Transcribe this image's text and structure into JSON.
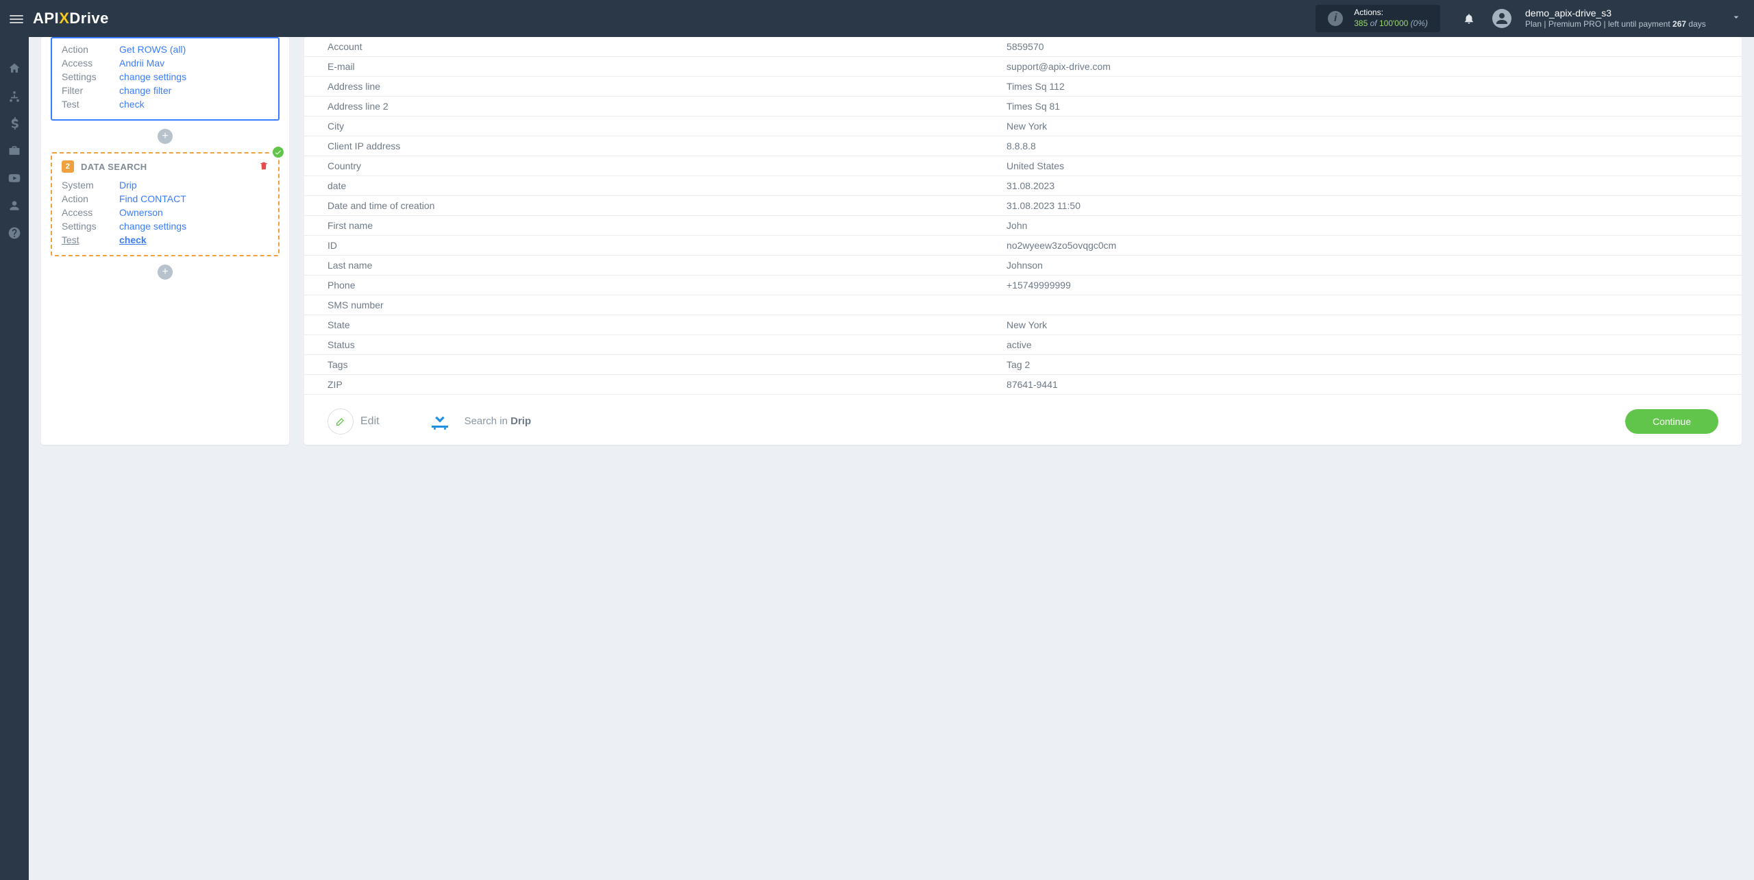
{
  "header": {
    "logo_api": "API",
    "logo_x": "X",
    "logo_drive": "Drive",
    "actions_label": "Actions:",
    "actions_used": "385",
    "actions_of": "of",
    "actions_total": "100'000",
    "actions_pct": "(0%)",
    "user_name": "demo_apix-drive_s3",
    "plan_prefix": "Plan |",
    "plan_name": "Premium PRO",
    "plan_suffix": "| left until payment",
    "plan_days_num": "267",
    "plan_days_label": "days"
  },
  "source_card": {
    "action_k": "Action",
    "action_v": "Get ROWS (all)",
    "access_k": "Access",
    "access_v": "Andrii Mav",
    "settings_k": "Settings",
    "settings_v": "change settings",
    "filter_k": "Filter",
    "filter_v": "change filter",
    "test_k": "Test",
    "test_v": "check"
  },
  "search_card": {
    "num": "2",
    "title": "DATA SEARCH",
    "system_k": "System",
    "system_v": "Drip",
    "action_k": "Action",
    "action_v": "Find CONTACT",
    "access_k": "Access",
    "access_v": "Ownerson",
    "settings_k": "Settings",
    "settings_v": "change settings",
    "test_k": "Test",
    "test_v": "check"
  },
  "data_rows": [
    {
      "k": "Account",
      "v": "5859570"
    },
    {
      "k": "E-mail",
      "v": "support@apix-drive.com"
    },
    {
      "k": "Address line",
      "v": "Times Sq 112"
    },
    {
      "k": "Address line 2",
      "v": "Times Sq 81"
    },
    {
      "k": "City",
      "v": "New York"
    },
    {
      "k": "Client IP address",
      "v": "8.8.8.8"
    },
    {
      "k": "Country",
      "v": "United States"
    },
    {
      "k": "date",
      "v": "31.08.2023"
    },
    {
      "k": "Date and time of creation",
      "v": "31.08.2023 11:50"
    },
    {
      "k": "First name",
      "v": "John"
    },
    {
      "k": "ID",
      "v": "no2wyeew3zo5ovqgc0cm"
    },
    {
      "k": "Last name",
      "v": "Johnson"
    },
    {
      "k": "Phone",
      "v": "+15749999999"
    },
    {
      "k": "SMS number",
      "v": ""
    },
    {
      "k": "State",
      "v": "New York"
    },
    {
      "k": "Status",
      "v": "active"
    },
    {
      "k": "Tags",
      "v": "Tag 2"
    },
    {
      "k": "ZIP",
      "v": "87641-9441"
    }
  ],
  "footer": {
    "edit_label": "Edit",
    "search_in": "Search in",
    "service": "Drip",
    "continue": "Continue"
  }
}
